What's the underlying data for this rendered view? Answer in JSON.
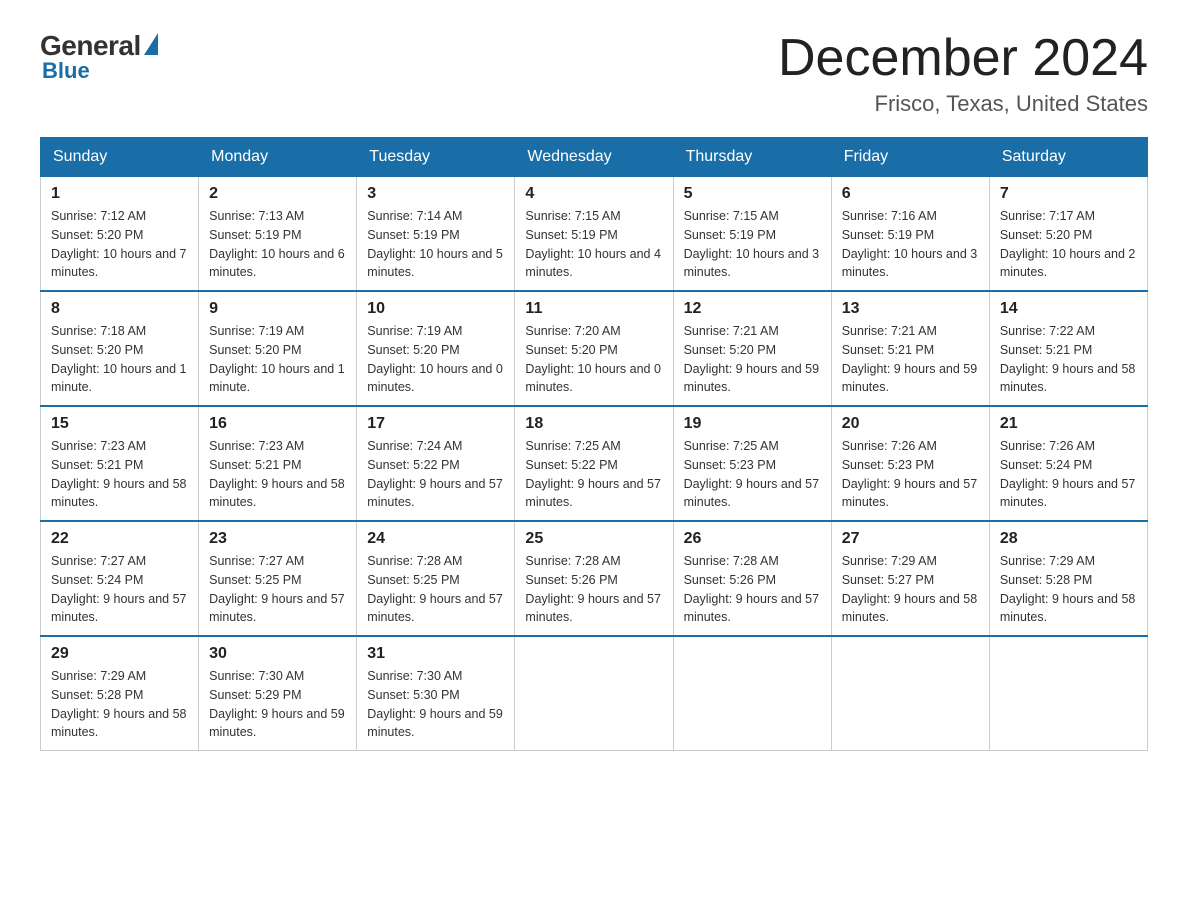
{
  "header": {
    "logo": {
      "general": "General",
      "blue": "Blue"
    },
    "title": "December 2024",
    "location": "Frisco, Texas, United States"
  },
  "days_of_week": [
    "Sunday",
    "Monday",
    "Tuesday",
    "Wednesday",
    "Thursday",
    "Friday",
    "Saturday"
  ],
  "weeks": [
    [
      {
        "day": "1",
        "sunrise": "7:12 AM",
        "sunset": "5:20 PM",
        "daylight": "10 hours and 7 minutes."
      },
      {
        "day": "2",
        "sunrise": "7:13 AM",
        "sunset": "5:19 PM",
        "daylight": "10 hours and 6 minutes."
      },
      {
        "day": "3",
        "sunrise": "7:14 AM",
        "sunset": "5:19 PM",
        "daylight": "10 hours and 5 minutes."
      },
      {
        "day": "4",
        "sunrise": "7:15 AM",
        "sunset": "5:19 PM",
        "daylight": "10 hours and 4 minutes."
      },
      {
        "day": "5",
        "sunrise": "7:15 AM",
        "sunset": "5:19 PM",
        "daylight": "10 hours and 3 minutes."
      },
      {
        "day": "6",
        "sunrise": "7:16 AM",
        "sunset": "5:19 PM",
        "daylight": "10 hours and 3 minutes."
      },
      {
        "day": "7",
        "sunrise": "7:17 AM",
        "sunset": "5:20 PM",
        "daylight": "10 hours and 2 minutes."
      }
    ],
    [
      {
        "day": "8",
        "sunrise": "7:18 AM",
        "sunset": "5:20 PM",
        "daylight": "10 hours and 1 minute."
      },
      {
        "day": "9",
        "sunrise": "7:19 AM",
        "sunset": "5:20 PM",
        "daylight": "10 hours and 1 minute."
      },
      {
        "day": "10",
        "sunrise": "7:19 AM",
        "sunset": "5:20 PM",
        "daylight": "10 hours and 0 minutes."
      },
      {
        "day": "11",
        "sunrise": "7:20 AM",
        "sunset": "5:20 PM",
        "daylight": "10 hours and 0 minutes."
      },
      {
        "day": "12",
        "sunrise": "7:21 AM",
        "sunset": "5:20 PM",
        "daylight": "9 hours and 59 minutes."
      },
      {
        "day": "13",
        "sunrise": "7:21 AM",
        "sunset": "5:21 PM",
        "daylight": "9 hours and 59 minutes."
      },
      {
        "day": "14",
        "sunrise": "7:22 AM",
        "sunset": "5:21 PM",
        "daylight": "9 hours and 58 minutes."
      }
    ],
    [
      {
        "day": "15",
        "sunrise": "7:23 AM",
        "sunset": "5:21 PM",
        "daylight": "9 hours and 58 minutes."
      },
      {
        "day": "16",
        "sunrise": "7:23 AM",
        "sunset": "5:21 PM",
        "daylight": "9 hours and 58 minutes."
      },
      {
        "day": "17",
        "sunrise": "7:24 AM",
        "sunset": "5:22 PM",
        "daylight": "9 hours and 57 minutes."
      },
      {
        "day": "18",
        "sunrise": "7:25 AM",
        "sunset": "5:22 PM",
        "daylight": "9 hours and 57 minutes."
      },
      {
        "day": "19",
        "sunrise": "7:25 AM",
        "sunset": "5:23 PM",
        "daylight": "9 hours and 57 minutes."
      },
      {
        "day": "20",
        "sunrise": "7:26 AM",
        "sunset": "5:23 PM",
        "daylight": "9 hours and 57 minutes."
      },
      {
        "day": "21",
        "sunrise": "7:26 AM",
        "sunset": "5:24 PM",
        "daylight": "9 hours and 57 minutes."
      }
    ],
    [
      {
        "day": "22",
        "sunrise": "7:27 AM",
        "sunset": "5:24 PM",
        "daylight": "9 hours and 57 minutes."
      },
      {
        "day": "23",
        "sunrise": "7:27 AM",
        "sunset": "5:25 PM",
        "daylight": "9 hours and 57 minutes."
      },
      {
        "day": "24",
        "sunrise": "7:28 AM",
        "sunset": "5:25 PM",
        "daylight": "9 hours and 57 minutes."
      },
      {
        "day": "25",
        "sunrise": "7:28 AM",
        "sunset": "5:26 PM",
        "daylight": "9 hours and 57 minutes."
      },
      {
        "day": "26",
        "sunrise": "7:28 AM",
        "sunset": "5:26 PM",
        "daylight": "9 hours and 57 minutes."
      },
      {
        "day": "27",
        "sunrise": "7:29 AM",
        "sunset": "5:27 PM",
        "daylight": "9 hours and 58 minutes."
      },
      {
        "day": "28",
        "sunrise": "7:29 AM",
        "sunset": "5:28 PM",
        "daylight": "9 hours and 58 minutes."
      }
    ],
    [
      {
        "day": "29",
        "sunrise": "7:29 AM",
        "sunset": "5:28 PM",
        "daylight": "9 hours and 58 minutes."
      },
      {
        "day": "30",
        "sunrise": "7:30 AM",
        "sunset": "5:29 PM",
        "daylight": "9 hours and 59 minutes."
      },
      {
        "day": "31",
        "sunrise": "7:30 AM",
        "sunset": "5:30 PM",
        "daylight": "9 hours and 59 minutes."
      },
      null,
      null,
      null,
      null
    ]
  ]
}
